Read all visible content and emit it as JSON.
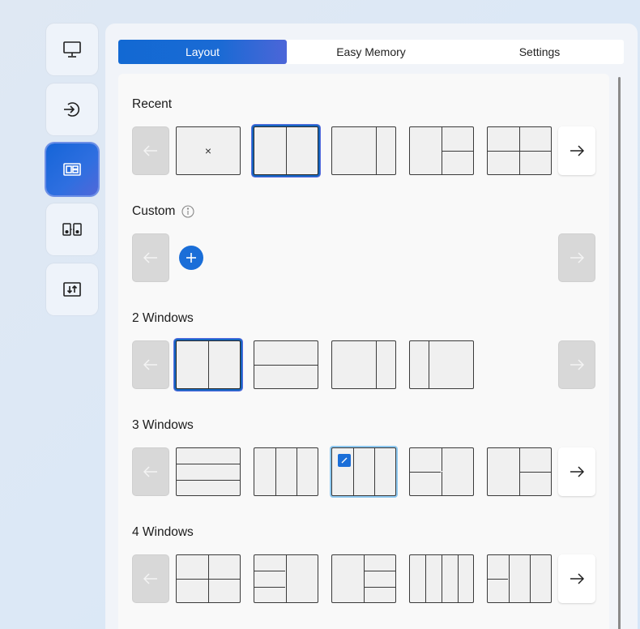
{
  "rail": {
    "items": [
      {
        "name": "monitor",
        "icon": "monitor-icon",
        "active": false
      },
      {
        "name": "input",
        "icon": "input-source-icon",
        "active": false
      },
      {
        "name": "layout",
        "icon": "layout-icon",
        "active": true
      },
      {
        "name": "speakers",
        "icon": "speakers-icon",
        "active": false
      },
      {
        "name": "adjust",
        "icon": "sort-adjust-icon",
        "active": false
      }
    ]
  },
  "tabs": [
    {
      "label": "Layout",
      "active": true
    },
    {
      "label": "Easy Memory",
      "active": false
    },
    {
      "label": "Settings",
      "active": false
    }
  ],
  "sections": {
    "recent": {
      "title": "Recent",
      "empty_tile_symbol": "×"
    },
    "custom": {
      "title": "Custom",
      "info_icon": "info-icon",
      "add_icon": "plus-icon"
    },
    "two_windows": {
      "title": "2 Windows"
    },
    "three_windows": {
      "title": "3 Windows"
    },
    "four_windows": {
      "title": "4 Windows"
    }
  },
  "colors": {
    "accent": "#1a6ed8",
    "accent_gradient_end": "#4c66d8",
    "selection_border": "#1565c0",
    "hover_border": "#8ec8f0"
  }
}
